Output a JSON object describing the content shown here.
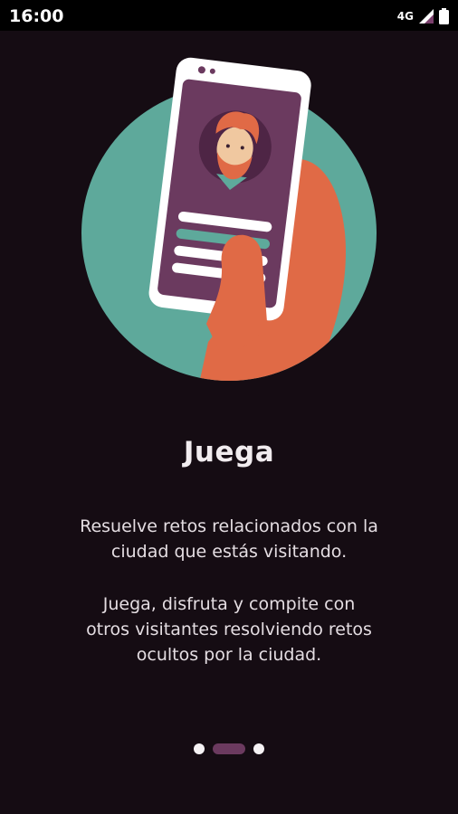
{
  "status_bar": {
    "time": "16:00",
    "network": "4G"
  },
  "slide": {
    "title": "Juega",
    "paragraph_1_line_1": "Resuelve retos relacionados con la",
    "paragraph_1_line_2": "ciudad que estás visitando.",
    "paragraph_2_line_1": "Juega, disfruta y compite con",
    "paragraph_2_line_2": "otros visitantes resolviendo retos",
    "paragraph_2_line_3": "ocultos por la ciudad."
  },
  "pager": {
    "total_pages": 3,
    "current_page": 2
  },
  "colors": {
    "background": "#150c13",
    "circle": "#5ea99b",
    "phone_screen": "#6b3a5f",
    "hand": "#e06a46",
    "active_dot": "#6b3a5f"
  },
  "icons": [
    "signal-icon",
    "battery-icon",
    "phone-illustration",
    "avatar-illustration"
  ]
}
